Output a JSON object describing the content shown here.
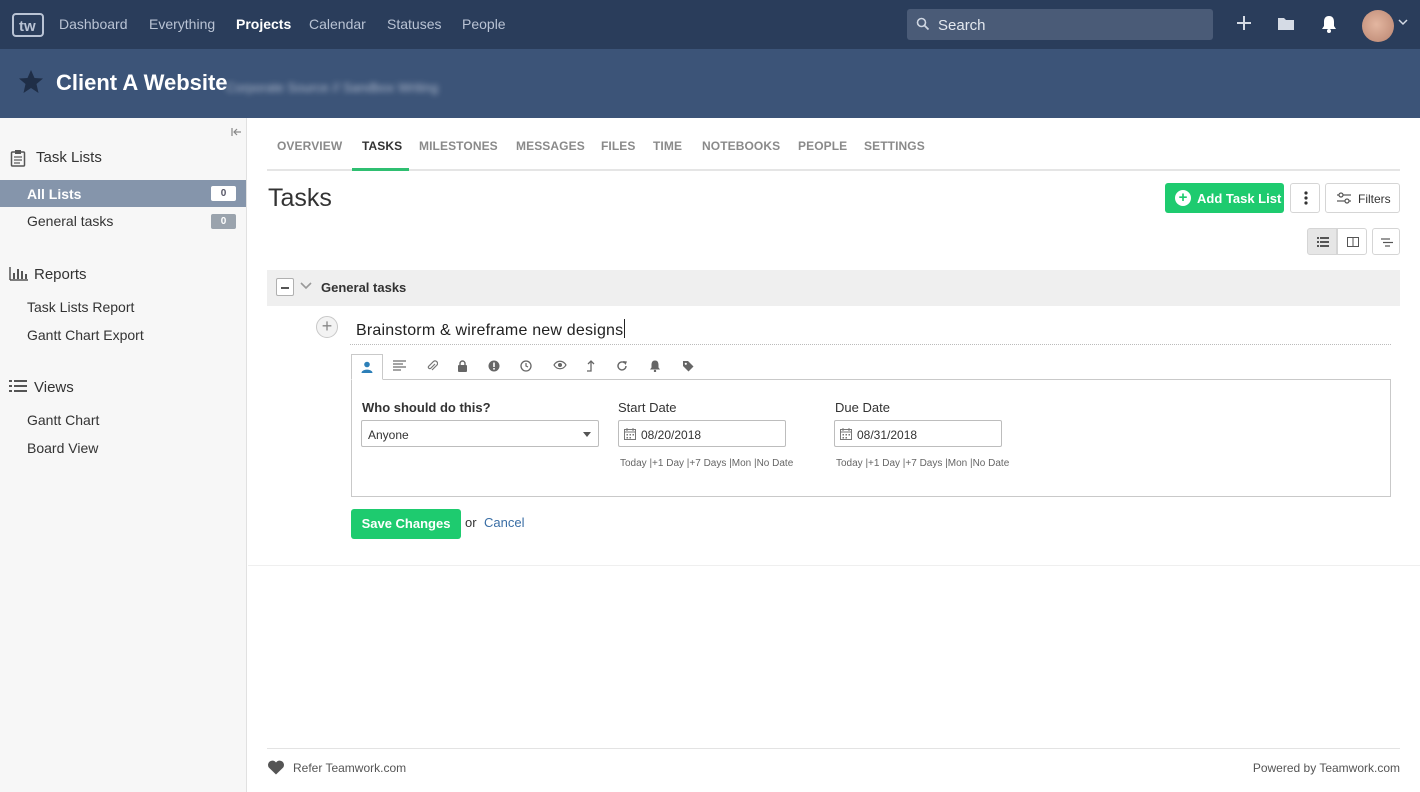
{
  "topnav": {
    "items": [
      "Dashboard",
      "Everything",
      "Projects",
      "Calendar",
      "Statuses",
      "People"
    ],
    "active": "Projects",
    "search_placeholder": "Search"
  },
  "project": {
    "title": "Client A Website",
    "company": "Corporate Source // Sandbox Writing"
  },
  "sidebar": {
    "task_lists_heading": "Task Lists",
    "all_lists": "All Lists",
    "all_lists_count": "0",
    "general_tasks": "General tasks",
    "general_tasks_count": "0",
    "reports_heading": "Reports",
    "reports": [
      "Task Lists Report",
      "Gantt Chart Export"
    ],
    "views_heading": "Views",
    "views": [
      "Gantt Chart",
      "Board View"
    ]
  },
  "tabs": [
    "OVERVIEW",
    "TASKS",
    "MILESTONES",
    "MESSAGES",
    "FILES",
    "TIME",
    "NOTEBOOKS",
    "PEOPLE",
    "SETTINGS"
  ],
  "active_tab": "TASKS",
  "main": {
    "title": "Tasks",
    "add_task_list": "Add Task List",
    "filters": "Filters",
    "list_name": "General tasks",
    "task_text": "Brainstorm & wireframe new designs"
  },
  "task_form": {
    "option_icons": [
      "person-icon",
      "description-icon",
      "attachment-icon",
      "lock-icon",
      "priority-icon",
      "time-icon",
      "followers-icon",
      "move-icon",
      "repeat-icon",
      "reminder-icon",
      "tag-icon"
    ],
    "assign_label": "Who should do this?",
    "assign_value": "Anyone",
    "start_label": "Start Date",
    "start_value": "08/20/2018",
    "due_label": "Due Date",
    "due_value": "08/31/2018",
    "shortcuts": "Today |+1 Day |+7 Days |Mon |No Date",
    "save": "Save Changes",
    "or": "or",
    "cancel": "Cancel"
  },
  "footer": {
    "refer": "Refer Teamwork.com",
    "powered": "Powered by Teamwork.com"
  },
  "colors": {
    "topnav": "#2a3d5b",
    "project_header": "#3c5478",
    "accent_green": "#1ecb6f",
    "sidebar_selected": "#8595ab",
    "link_blue": "#3a6ea5"
  }
}
